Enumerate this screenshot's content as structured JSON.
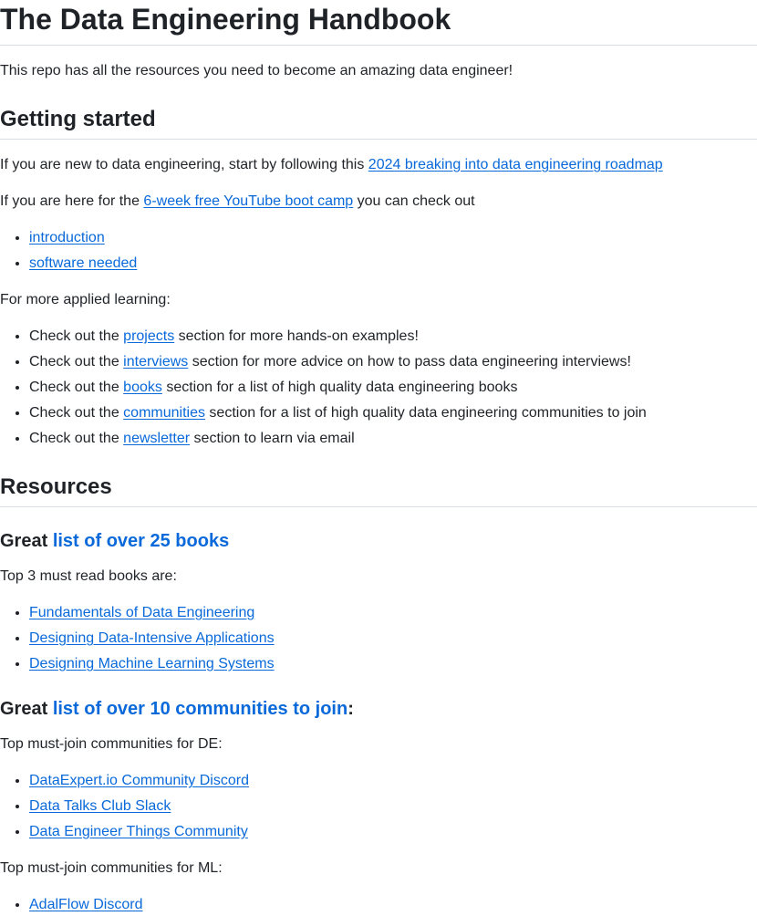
{
  "title": "The Data Engineering Handbook",
  "intro": "This repo has all the resources you need to become an amazing data engineer!",
  "getting_started": {
    "heading": "Getting started",
    "p1_prefix": "If you are new to data engineering, start by following this ",
    "p1_link": "2024 breaking into data engineering roadmap",
    "p2_prefix": "If you are here for the ",
    "p2_link": "6-week free YouTube boot camp",
    "p2_suffix": " you can check out",
    "bootcamp_links": [
      "introduction",
      "software needed"
    ],
    "applied_intro": "For more applied learning:",
    "applied_items": [
      {
        "prefix": "Check out the ",
        "link": "projects",
        "suffix": " section for more hands-on examples!"
      },
      {
        "prefix": "Check out the ",
        "link": "interviews",
        "suffix": " section for more advice on how to pass data engineering interviews!"
      },
      {
        "prefix": "Check out the ",
        "link": "books",
        "suffix": " section for a list of high quality data engineering books"
      },
      {
        "prefix": "Check out the ",
        "link": "communities",
        "suffix": " section for a list of high quality data engineering communities to join"
      },
      {
        "prefix": "Check out the ",
        "link": "newsletter",
        "suffix": " section to learn via email"
      }
    ]
  },
  "resources": {
    "heading": "Resources",
    "books": {
      "heading_prefix": "Great ",
      "heading_link": "list of over 25 books",
      "intro": "Top 3 must read books are:",
      "items": [
        "Fundamentals of Data Engineering",
        "Designing Data-Intensive Applications",
        "Designing Machine Learning Systems"
      ]
    },
    "communities": {
      "heading_prefix": "Great ",
      "heading_link": "list of over 10 communities to join",
      "heading_suffix": ":",
      "de_intro": "Top must-join communities for DE:",
      "de_items": [
        "DataExpert.io Community Discord",
        "Data Talks Club Slack",
        "Data Engineer Things Community"
      ],
      "ml_intro": "Top must-join communities for ML:",
      "ml_items": [
        "AdalFlow Discord"
      ]
    }
  }
}
